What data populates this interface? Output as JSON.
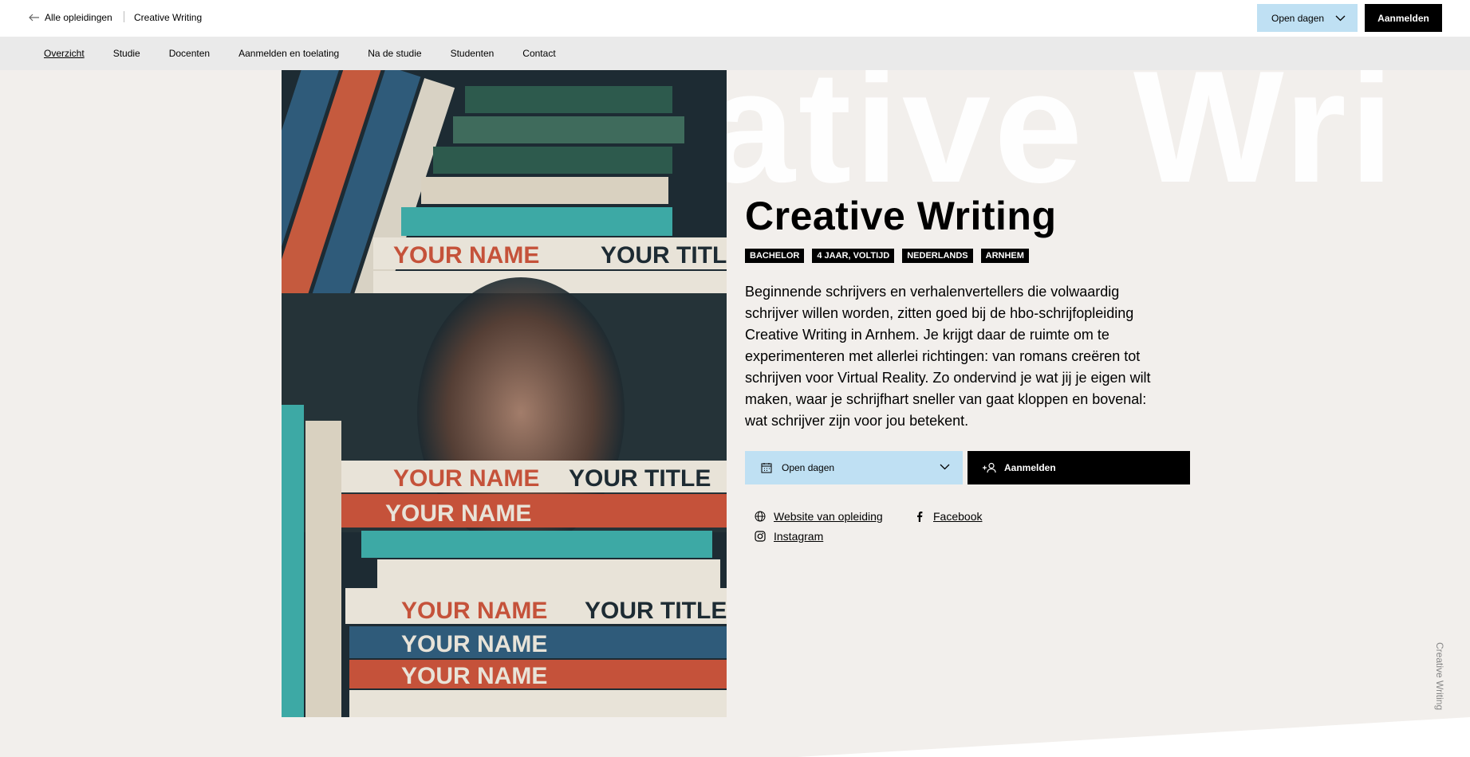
{
  "topbar": {
    "back_label": "Alle opleidingen",
    "current": "Creative Writing",
    "open_days": "Open dagen",
    "apply": "Aanmelden"
  },
  "nav": {
    "items": [
      "Overzicht",
      "Studie",
      "Docenten",
      "Aanmelden en toelating",
      "Na de studie",
      "Studenten",
      "Contact"
    ]
  },
  "hero": {
    "bg_text": "Creative Wri",
    "title": "Creative Writing",
    "tags": [
      "BACHELOR",
      "4 JAAR, VOLTIJD",
      "NEDERLANDS",
      "ARNHEM"
    ],
    "intro": "Beginnende schrijvers en verhalenvertellers die volwaardig schrijver willen worden, zitten goed bij de hbo-schrijfopleiding Creative Writing in Arnhem. Je krijgt daar de ruimte om te experimenteren met allerlei richtingen: van romans creëren tot schrijven voor Virtual Reality. Zo ondervind je wat jij je eigen wilt maken, waar je schrijfhart sneller van gaat kloppen en bovenal: wat schrijver zijn voor jou betekent.",
    "image_book_name": "YOUR NAME",
    "image_book_title": "YOUR TITLE"
  },
  "actions": {
    "open_days": "Open dagen",
    "apply": "Aanmelden"
  },
  "links": {
    "website": "Website van opleiding",
    "facebook": "Facebook",
    "instagram": "Instagram"
  },
  "side_label": "Creative Writing",
  "colors": {
    "accent_blue": "#bfe0f3",
    "background": "#f2efec"
  }
}
